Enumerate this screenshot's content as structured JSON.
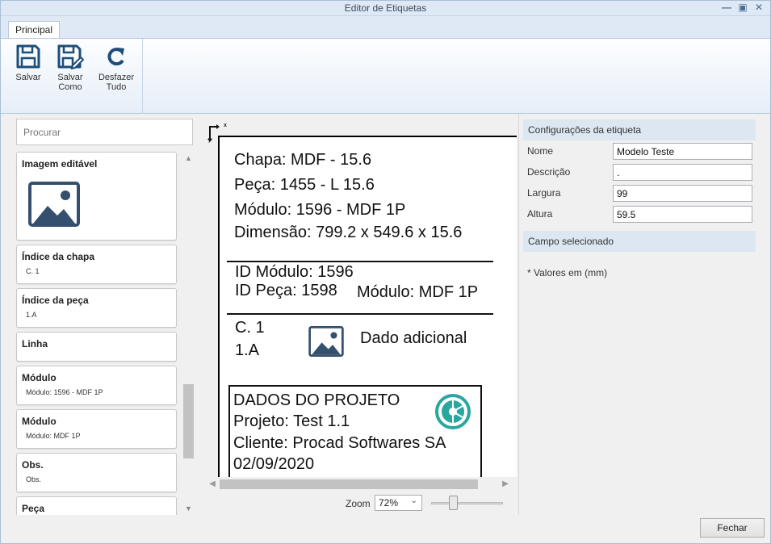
{
  "window": {
    "title": "Editor de Etiquetas"
  },
  "ribbon": {
    "tab": "Principal",
    "buttons": [
      {
        "label": "Salvar",
        "icon": "save-icon"
      },
      {
        "label_line1": "Salvar",
        "label_line2": "Como",
        "icon": "save-as-icon"
      },
      {
        "label_line1": "Desfazer",
        "label_line2": "Tudo",
        "icon": "undo-all-icon"
      }
    ]
  },
  "left": {
    "search_placeholder": "Procurar",
    "items": [
      {
        "title": "Imagem editável",
        "icon": "image-icon"
      },
      {
        "title": "Índice da chapa",
        "subtitle": "C. 1"
      },
      {
        "title": "Índice da peça",
        "subtitle": "1.A"
      },
      {
        "title": "Linha"
      },
      {
        "title": "Módulo",
        "subtitle": "Módulo: 1596 - MDF 1P"
      },
      {
        "title": "Módulo",
        "subtitle": "Módulo: MDF 1P"
      },
      {
        "title": "Obs.",
        "subtitle": "Obs."
      },
      {
        "title": "Peça"
      }
    ]
  },
  "label": {
    "axis_x": "x",
    "axis_y": "y",
    "chapa": "Chapa: MDF - 15.6",
    "peca": "Peça: 1455 - L 15.6",
    "modulo": "Módulo: 1596 - MDF 1P",
    "dimensao": "Dimensão: 799.2 x 549.6 x 15.6",
    "id_modulo": "ID Módulo: 1596",
    "id_peca": "ID Peça: 1598",
    "modulo_short": "Módulo: MDF 1P",
    "indice_chapa": "C. 1",
    "indice_peca": "1.A",
    "dado_adicional": "Dado adicional",
    "proj_title": "DADOS DO PROJETO",
    "projeto": "Projeto: Test 1.1",
    "cliente": "Cliente: Procad Softwares SA",
    "data": "02/09/2020"
  },
  "zoom": {
    "label": "Zoom",
    "value": "72%"
  },
  "right": {
    "config_header": "Configurações da etiqueta",
    "fields": [
      {
        "label": "Nome",
        "value": "Modelo Teste"
      },
      {
        "label": "Descrição",
        "value": "."
      },
      {
        "label": "Largura",
        "value": "99"
      },
      {
        "label": "Altura",
        "value": "59.5"
      }
    ],
    "selected_header": "Campo selecionado",
    "note": "* Valores em (mm)"
  },
  "footer": {
    "close_label": "Fechar"
  },
  "colors": {
    "logo_teal": "#2aa6a0",
    "ribbon_blue": "#1d4d79",
    "image_icon": "#34506e"
  }
}
